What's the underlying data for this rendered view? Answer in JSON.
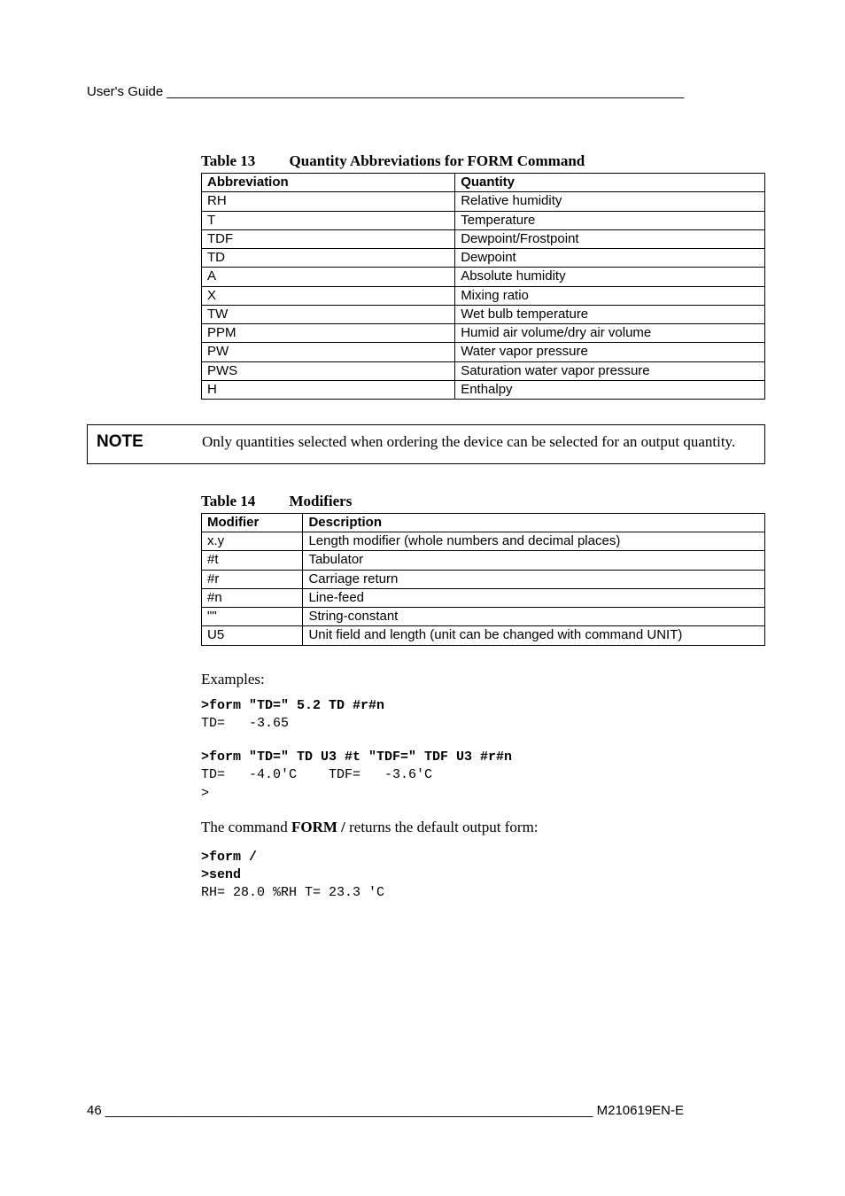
{
  "header": {
    "text": "User's Guide ______________________________________________________________________"
  },
  "table13": {
    "caption_num": "Table 13",
    "caption_title": "Quantity Abbreviations for FORM Command",
    "headers": [
      "Abbreviation",
      "Quantity"
    ],
    "rows": [
      [
        "RH",
        "Relative humidity"
      ],
      [
        "T",
        "Temperature"
      ],
      [
        "TDF",
        "Dewpoint/Frostpoint"
      ],
      [
        "TD",
        "Dewpoint"
      ],
      [
        "A",
        "Absolute humidity"
      ],
      [
        "X",
        "Mixing ratio"
      ],
      [
        "TW",
        "Wet bulb temperature"
      ],
      [
        "PPM",
        "Humid air volume/dry air volume"
      ],
      [
        "PW",
        "Water vapor pressure"
      ],
      [
        "PWS",
        "Saturation water vapor pressure"
      ],
      [
        "H",
        "Enthalpy"
      ]
    ]
  },
  "note": {
    "label": "NOTE",
    "body": "Only quantities selected when ordering the device can be selected for an output quantity."
  },
  "table14": {
    "caption_num": "Table 14",
    "caption_title": "Modifiers",
    "headers": [
      "Modifier",
      "Description"
    ],
    "rows": [
      [
        "x.y",
        "Length modifier (whole numbers and decimal places)"
      ],
      [
        "#t",
        "Tabulator"
      ],
      [
        "#r",
        "Carriage return"
      ],
      [
        "#n",
        "Line-feed"
      ],
      [
        "\"\"",
        "String-constant"
      ],
      [
        "U5",
        "Unit field and length (unit can be changed with command UNIT)"
      ]
    ]
  },
  "examples": {
    "heading": "Examples:",
    "block1_cmd": ">form \"TD=\" 5.2 TD #r#n",
    "block1_out": "TD=   -3.65",
    "block2_cmd": ">form \"TD=\" TD U3 #t \"TDF=\" TDF U3 #r#n",
    "block2_out": "TD=   -4.0'C    TDF=   -3.6'C\n>",
    "mid_text_pre": "The command ",
    "mid_text_bold": "FORM /",
    "mid_text_post": " returns the default output form:",
    "block3_cmd1": ">form /",
    "block3_cmd2": ">send",
    "block3_out": "RH= 28.0 %RH T= 23.3 'C"
  },
  "footer": {
    "left": "46 __________________________________________________________________",
    "right": " M210619EN-E"
  }
}
